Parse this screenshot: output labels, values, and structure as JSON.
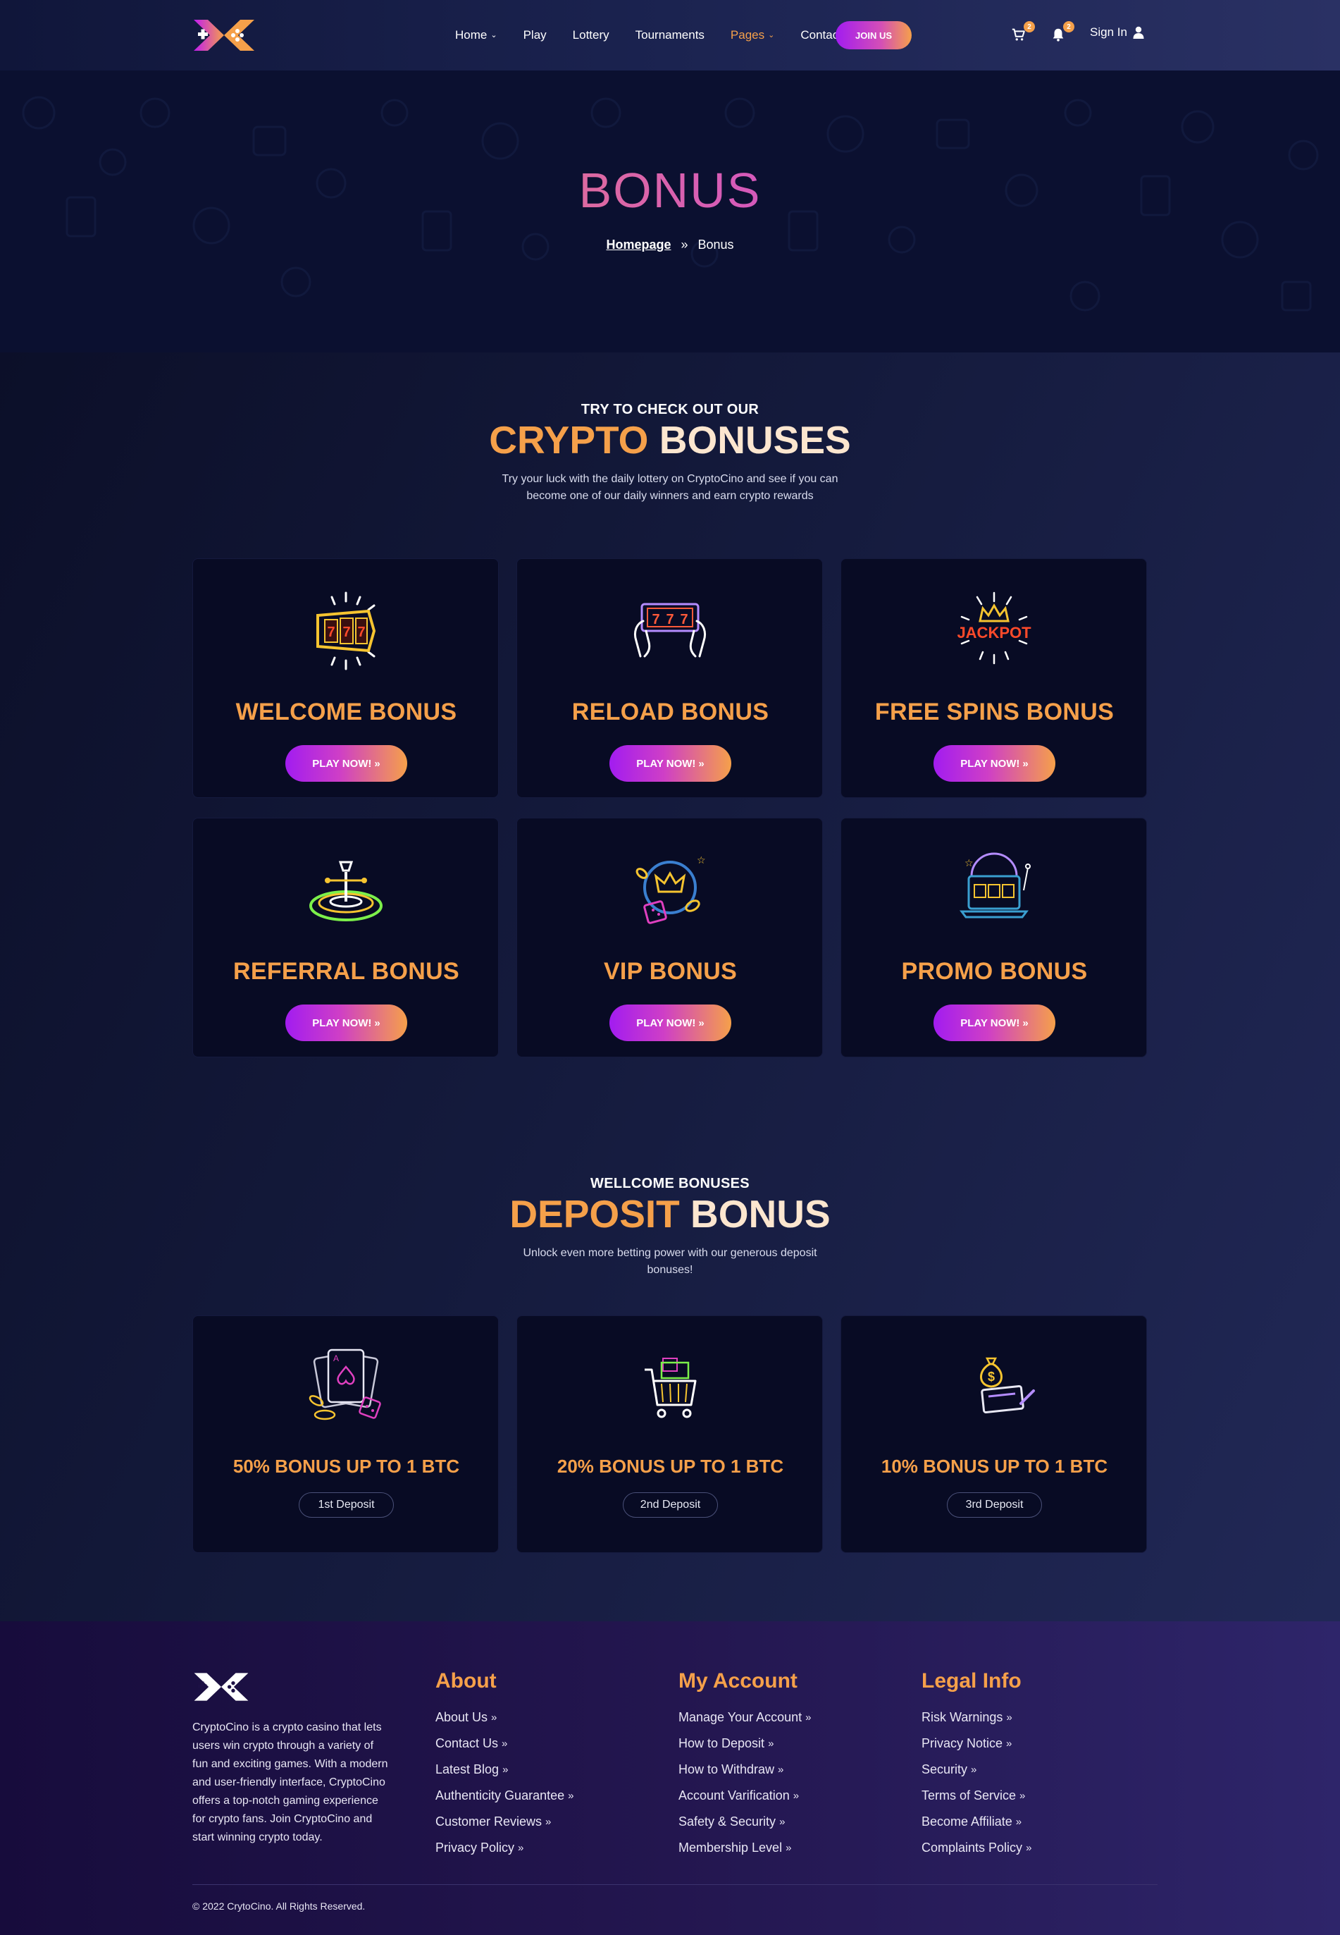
{
  "nav": {
    "items": [
      {
        "label": "Home",
        "has_dropdown": true,
        "active": false
      },
      {
        "label": "Play",
        "has_dropdown": false,
        "active": false
      },
      {
        "label": "Lottery",
        "has_dropdown": false,
        "active": false
      },
      {
        "label": "Tournaments",
        "has_dropdown": false,
        "active": false
      },
      {
        "label": "Pages",
        "has_dropdown": true,
        "active": true
      },
      {
        "label": "Contact",
        "has_dropdown": false,
        "active": false
      }
    ],
    "join_label": "JOIN US",
    "cart_count": "2",
    "notification_count": "2",
    "signin_label": "Sign In"
  },
  "hero": {
    "title": "BONUS",
    "breadcrumb_home": "Homepage",
    "breadcrumb_current": "Bonus"
  },
  "crypto_section": {
    "kicker": "TRY TO CHECK OUT OUR",
    "title_word1": "CRYPTO",
    "title_word2": "BONUSES",
    "description": "Try your luck with the daily lottery on CryptoCino and see if you can become one of our daily winners and earn crypto rewards",
    "play_label": "PLAY NOW!",
    "cards": [
      {
        "title": "WELCOME BONUS",
        "icon": "slot-reel-icon"
      },
      {
        "title": "RELOAD BONUS",
        "icon": "mobile-slot-icon"
      },
      {
        "title": "FREE SPINS BONUS",
        "icon": "jackpot-icon"
      },
      {
        "title": "REFERRAL BONUS",
        "icon": "roulette-icon"
      },
      {
        "title": "VIP BONUS",
        "icon": "vip-crown-icon"
      },
      {
        "title": "PROMO BONUS",
        "icon": "laptop-slot-icon"
      }
    ]
  },
  "deposit_section": {
    "kicker": "WELLCOME BONUSES",
    "title_word1": "DEPOSIT",
    "title_word2": "BONUS",
    "description": "Unlock even more betting power with our generous deposit bonuses!",
    "cards": [
      {
        "title": "50% BONUS UP TO 1 BTC",
        "pill": "1st Deposit",
        "icon": "cards-dice-icon"
      },
      {
        "title": "20% BONUS UP TO 1 BTC",
        "pill": "2nd Deposit",
        "icon": "shopping-cart-icon"
      },
      {
        "title": "10% BONUS UP TO 1 BTC",
        "pill": "3rd Deposit",
        "icon": "money-bag-icon"
      }
    ]
  },
  "footer": {
    "about_text": "CryptoCino is a crypto casino that lets users win crypto through a variety of fun and exciting games. With a modern and user-friendly interface, CryptoCino offers a top-notch gaming experience for crypto fans. Join CryptoCino and start winning crypto today.",
    "columns": [
      {
        "title": "About",
        "links": [
          "About Us",
          "Contact Us",
          "Latest Blog",
          "Authenticity Guarantee",
          "Customer Reviews",
          "Privacy Policy"
        ]
      },
      {
        "title": "My Account",
        "links": [
          "Manage Your Account",
          "How to Deposit",
          "How to Withdraw",
          "Account Varification",
          "Safety & Security",
          "Membership Level"
        ]
      },
      {
        "title": "Legal Info",
        "links": [
          "Risk Warnings",
          "Privacy Notice",
          "Security",
          "Terms of Service",
          "Become Affiliate",
          "Complaints Policy"
        ]
      }
    ],
    "copyright": "© 2022 CrytoCino. All Rights Reserved."
  },
  "colors": {
    "accent_orange": "#f5a04a",
    "accent_purple": "#a21cf0",
    "card_bg": "#080b24"
  }
}
